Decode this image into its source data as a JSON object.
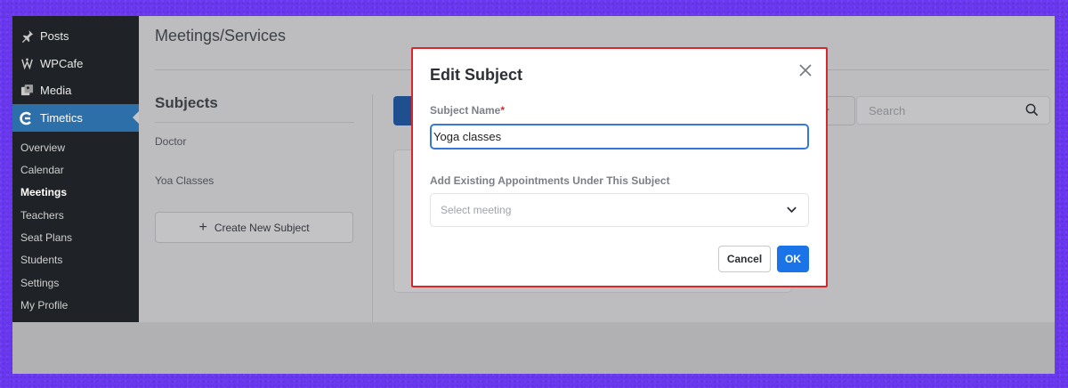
{
  "sidebar": {
    "top_items": [
      {
        "label": "Posts",
        "icon": "pin-icon"
      },
      {
        "label": "WPCafe",
        "icon": "wpcafe-icon"
      },
      {
        "label": "Media",
        "icon": "media-icon"
      }
    ],
    "active_item": {
      "label": "Timetics",
      "icon": "timetics-icon"
    },
    "sub_items": [
      "Overview",
      "Calendar",
      "Meetings",
      "Teachers",
      "Seat Plans",
      "Students",
      "Settings",
      "My Profile"
    ],
    "current_sub": "Meetings"
  },
  "main": {
    "page_title": "Meetings/Services",
    "subjects_heading": "Subjects",
    "subjects": [
      "Doctor",
      "Yoa Classes"
    ],
    "create_button": "Create New Subject",
    "filter_partial": "er",
    "search_placeholder": "Search"
  },
  "modal": {
    "title": "Edit Subject",
    "subject_name_label": "Subject Name",
    "required_mark": "*",
    "subject_name_value": "Yoga classes",
    "appointments_label": "Add Existing Appointments Under This Subject",
    "select_placeholder": "Select meeting",
    "cancel_label": "Cancel",
    "ok_label": "OK"
  },
  "colors": {
    "accent": "#1b73e8",
    "sidebar_bg": "#1f2327",
    "sidebar_active": "#2d70a9",
    "highlight_border": "#d9262a",
    "background": "#6a38f0"
  }
}
